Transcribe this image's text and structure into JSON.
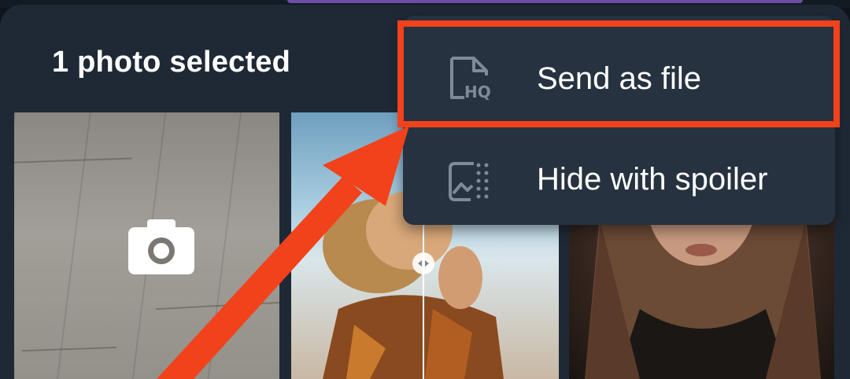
{
  "sheet": {
    "title": "1 photo selected"
  },
  "menu": {
    "items": [
      {
        "label": "Send as file",
        "icon": "hq-file-icon"
      },
      {
        "label": "Hide with spoiler",
        "icon": "spoiler-icon"
      }
    ]
  },
  "gallery": {
    "tiles": [
      {
        "kind": "camera",
        "icon": "camera-icon"
      },
      {
        "kind": "photo"
      },
      {
        "kind": "photo"
      }
    ]
  },
  "colors": {
    "sheet_bg": "#1f2936",
    "menu_bg": "#26323f",
    "annotation_red": "#f2421b",
    "accent": "#6b4ea8"
  }
}
